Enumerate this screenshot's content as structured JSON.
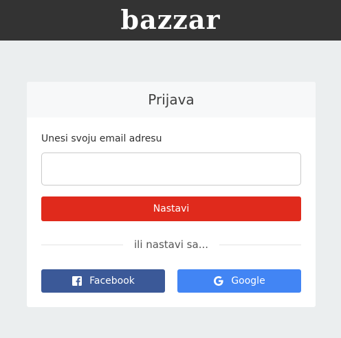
{
  "header": {
    "logo_text": "bazzar",
    "background_color": "#333333"
  },
  "login_card": {
    "title": "Prijava",
    "email": {
      "label": "Unesi svoju email adresu",
      "value": "",
      "placeholder": ""
    },
    "continue_label": "Nastavi",
    "continue_color": "#e02a1c",
    "divider_text": "ili nastavi sa...",
    "facebook": {
      "label": "Facebook",
      "icon": "facebook-icon",
      "color": "#3b5998"
    },
    "google": {
      "label": "Google",
      "icon": "google-icon",
      "color": "#4285f4"
    }
  }
}
